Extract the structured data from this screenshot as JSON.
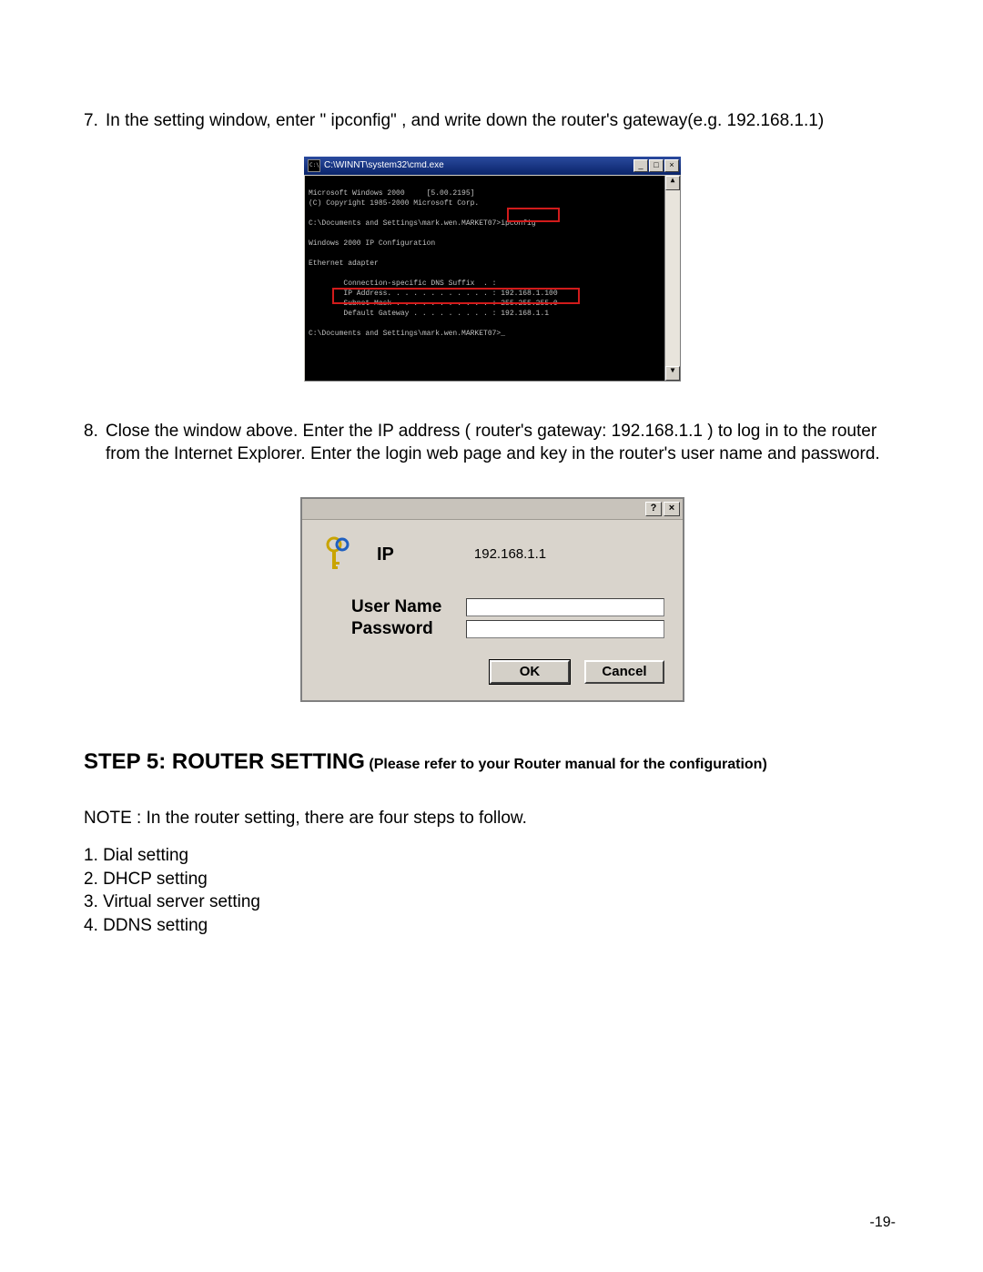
{
  "step7": {
    "num": "7.",
    "text": "In the setting window, enter \" ipconfig\" , and write down the router's gateway(e.g. 192.168.1.1)"
  },
  "cmd": {
    "title": "C:\\WINNT\\system32\\cmd.exe",
    "btn_min": "_",
    "btn_max": "□",
    "btn_close": "×",
    "lines": {
      "l1": "Microsoft Windows 2000     [5.00.2195]",
      "l2": "(C) Copyright 1985-2000 Microsoft Corp.",
      "l3": "",
      "l4a": "C:\\Documents and Settings\\mark.wen.MARKET07>",
      "l4b": "ipconfig",
      "l5": "",
      "l6": "Windows 2000 IP Configuration",
      "l7": "",
      "l8": "Ethernet adapter",
      "l9": "",
      "l10": "        Connection-specific DNS Suffix  . :",
      "l11": "        IP Address. . . . . . . . . . . . : 192.168.1.100",
      "l12": "        Subnet Mask . . . . . . . . . . . : 255.255.255.0",
      "l13": "        Default Gateway . . . . . . . . . : 192.168.1.1",
      "l14": "",
      "l15": "C:\\Documents and Settings\\mark.wen.MARKET07>_"
    },
    "scroll_up": "▲",
    "scroll_down": "▼"
  },
  "step8": {
    "num": "8.",
    "text": "Close the window above. Enter the IP address ( router's gateway: 192.168.1.1 ) to log in to the router from the Internet Explorer.  Enter the login web page and key in the router's user name and password."
  },
  "login": {
    "help": "?",
    "close": "×",
    "ip_label": "IP",
    "ip_value": "192.168.1.1",
    "user_label": "User Name",
    "pass_label": "Password",
    "ok": "OK",
    "cancel": "Cancel"
  },
  "step5": {
    "big": "STEP 5: ROUTER SETTING",
    "small": " (Please refer to your Router manual for the configuration)"
  },
  "note": "NOTE : In the router setting, there are four steps to follow.",
  "routersteps": {
    "s1": "1. Dial setting",
    "s2": "2. DHCP setting",
    "s3": "3. Virtual server setting",
    "s4": "4. DDNS setting"
  },
  "pagenum": "-19-"
}
